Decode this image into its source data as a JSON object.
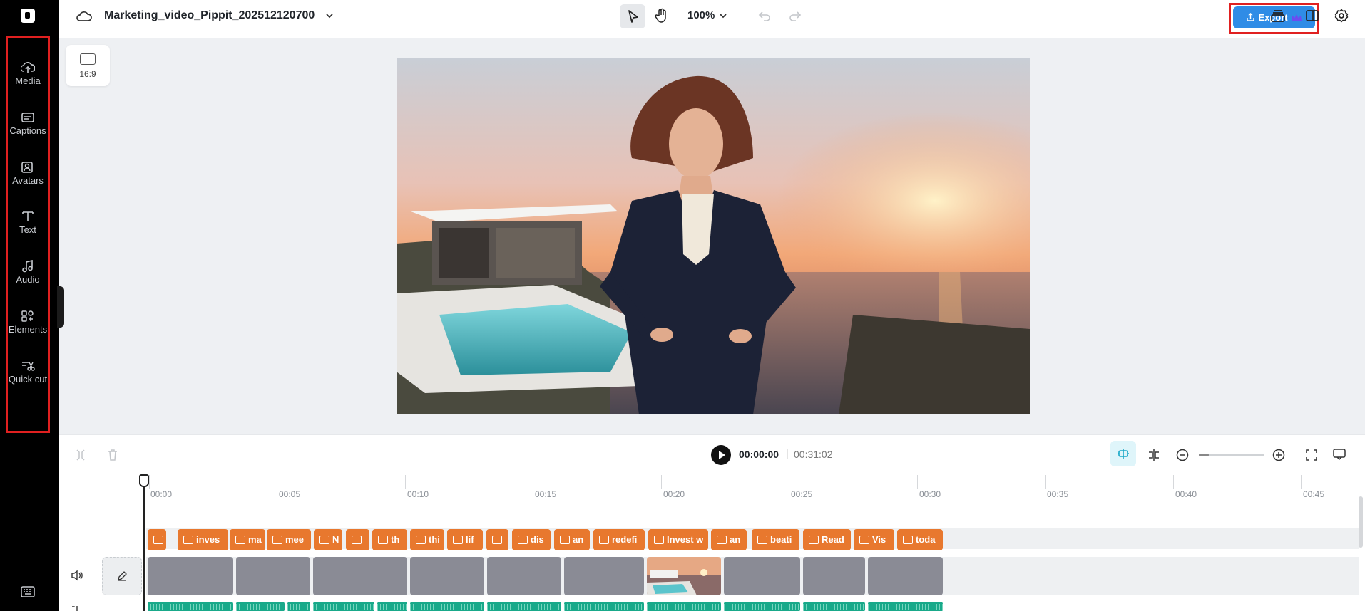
{
  "topbar": {
    "project_title": "Marketing_video_Pippit_202512120700",
    "zoom": "100%",
    "export_label": "Export"
  },
  "sidebar": {
    "items": [
      {
        "label": "Media",
        "icon": "cloud-upload-icon"
      },
      {
        "label": "Captions",
        "icon": "captions-icon"
      },
      {
        "label": "Avatars",
        "icon": "avatar-icon"
      },
      {
        "label": "Text",
        "icon": "text-icon"
      },
      {
        "label": "Audio",
        "icon": "music-note-icon"
      },
      {
        "label": "Elements",
        "icon": "elements-icon"
      },
      {
        "label": "Quick cut",
        "icon": "scissors-icon"
      }
    ]
  },
  "canvas": {
    "aspect_ratio": "16:9"
  },
  "timeline": {
    "current_time": "00:00:00",
    "separator": "|",
    "total_time": "00:31:02",
    "ruler_labels": [
      "00:00",
      "00:05",
      "00:10",
      "00:15",
      "00:20",
      "00:25",
      "00:30",
      "00:35",
      "00:40",
      "00:45"
    ],
    "captions": [
      "\\",
      "inves",
      "ma",
      "mee",
      "N",
      "",
      "th",
      "thi",
      "lif",
      "",
      "dis",
      "an",
      "redefi",
      "Invest w",
      "an",
      "beati",
      "Read",
      "Vis",
      "toda"
    ]
  },
  "colors": {
    "accent": "#2f8ce6",
    "caption_clip": "#e8782e",
    "audio_clip": "#19a98a",
    "video_clip": "#8a8b95",
    "highlight_box": "#e02020"
  }
}
